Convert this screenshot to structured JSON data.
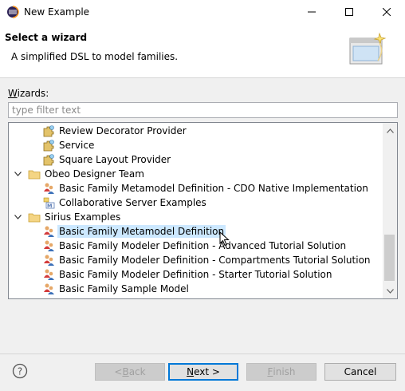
{
  "window": {
    "title": "New Example",
    "minimize_glyph": "—",
    "maximize_glyph": "☐",
    "close_glyph": "✕"
  },
  "banner": {
    "heading": "Select a wizard",
    "description": "A simplified DSL to model families."
  },
  "wizards": {
    "label_mnemonic": "W",
    "label_rest": "izards:",
    "filter_placeholder": "type filter text",
    "filter_value": ""
  },
  "tree": {
    "items": [
      {
        "label": "Review Decorator Provider",
        "level": 2,
        "icon": "plugin-icon"
      },
      {
        "label": "Service",
        "level": 2,
        "icon": "plugin-icon"
      },
      {
        "label": "Square Layout Provider",
        "level": 2,
        "icon": "plugin-icon"
      },
      {
        "label": "Obeo Designer Team",
        "level": 1,
        "icon": "folder-icon",
        "expanded": true
      },
      {
        "label": "Basic Family Metamodel Definition - CDO Native Implementation",
        "level": 2,
        "icon": "example-project-icon"
      },
      {
        "label": "Collaborative Server Examples",
        "level": 2,
        "icon": "model-example-icon"
      },
      {
        "label": "Sirius Examples",
        "level": 1,
        "icon": "folder-icon",
        "expanded": true
      },
      {
        "label": "Basic Family Metamodel Definition",
        "level": 2,
        "icon": "example-project-icon",
        "selected": true
      },
      {
        "label": "Basic Family Modeler Definition - Advanced Tutorial Solution",
        "level": 2,
        "icon": "example-project-icon"
      },
      {
        "label": "Basic Family Modeler Definition - Compartments Tutorial Solution",
        "level": 2,
        "icon": "example-project-icon"
      },
      {
        "label": "Basic Family Modeler Definition - Starter Tutorial Solution",
        "level": 2,
        "icon": "example-project-icon"
      },
      {
        "label": "Basic Family Sample Model",
        "level": 2,
        "icon": "example-project-icon"
      }
    ]
  },
  "buttons": {
    "back_prefix": "< ",
    "back_mnemonic": "B",
    "back_rest": "ack",
    "next_mnemonic": "N",
    "next_rest": "ext >",
    "finish_mnemonic": "F",
    "finish_rest": "inish",
    "cancel": "Cancel",
    "help_glyph": "?"
  },
  "colors": {
    "selection": "#cce8ff",
    "accent": "#0078d7"
  }
}
